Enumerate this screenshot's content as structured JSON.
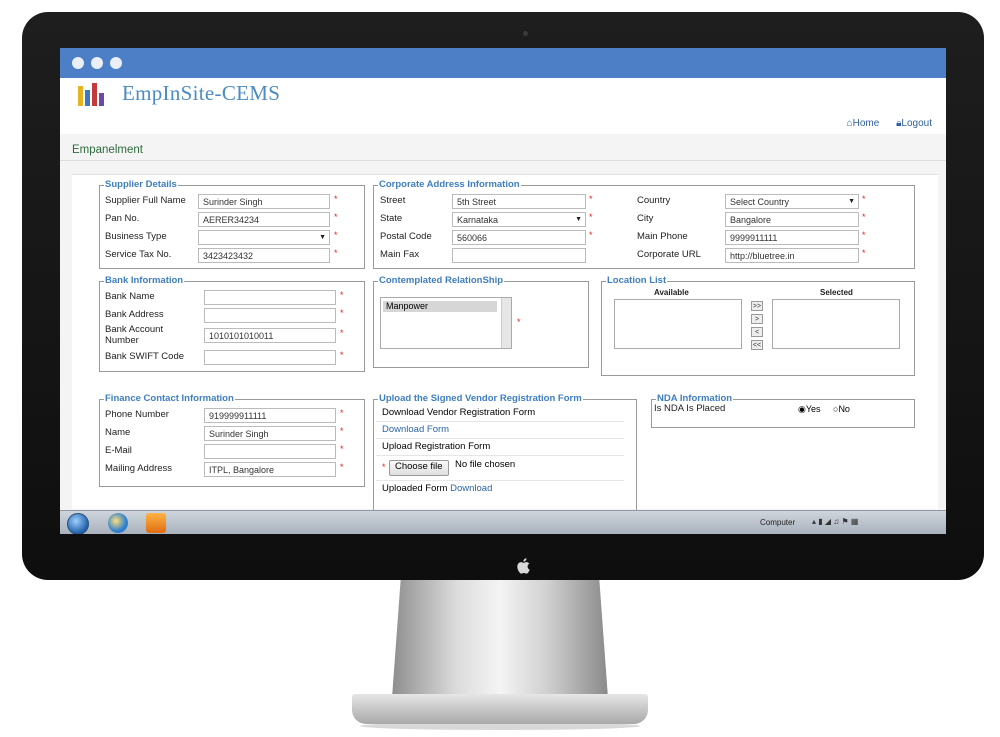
{
  "app": {
    "logo_text": "EmpInSite-CEMS",
    "nav": {
      "home": "Home",
      "logout": "Logout"
    },
    "page_title": "Empanelment"
  },
  "supplier": {
    "legend": "Supplier Details",
    "full_name_label": "Supplier Full Name",
    "full_name_value": "Surinder Singh",
    "pan_label": "Pan No.",
    "pan_value": "AERER34234",
    "business_type_label": "Business Type",
    "business_type_value": "",
    "service_tax_label": "Service Tax No.",
    "service_tax_value": "3423423432"
  },
  "address": {
    "legend": "Corporate Address Information",
    "street_label": "Street",
    "street_value": "5th Street",
    "state_label": "State",
    "state_value": "Karnataka",
    "postal_label": "Postal Code",
    "postal_value": "560066",
    "fax_label": "Main Fax",
    "fax_value": "",
    "country_label": "Country",
    "country_value": "Select Country",
    "city_label": "City",
    "city_value": "Bangalore",
    "phone_label": "Main Phone",
    "phone_value": "9999911111",
    "url_label": "Corporate URL",
    "url_value": "http://bluetree.in"
  },
  "bank": {
    "legend": "Bank Information",
    "name_label": "Bank Name",
    "name_value": "",
    "address_label": "Bank Address",
    "address_value": "",
    "account_label_1": "Bank Account",
    "account_label_2": "Number",
    "account_value": "1010101010011",
    "swift_label": "Bank SWIFT Code",
    "swift_value": ""
  },
  "relationship": {
    "legend": "Contemplated RelationShip",
    "options": [
      "Manpower"
    ]
  },
  "location": {
    "legend": "Location List",
    "available_label": "Available",
    "selected_label": "Selected",
    "buttons": [
      ">>",
      ">",
      "<",
      "<<"
    ]
  },
  "finance": {
    "legend": "Finance Contact Information",
    "phone_label": "Phone Number",
    "phone_value": "919999911111",
    "name_label": "Name",
    "name_value": "Surinder Singh",
    "email_label": "E-Mail",
    "email_value": "",
    "mailing_label": "Mailing Address",
    "mailing_value": "ITPL, Bangalore"
  },
  "upload": {
    "legend": "Upload the Signed Vendor Registration Form",
    "download_title": "Download Vendor Registration Form",
    "download_link": "Download Form",
    "upload_title": "Upload Registration Form",
    "choose_button": "Choose file",
    "no_file": "No file chosen",
    "uploaded_prefix": "Uploaded Form",
    "uploaded_link": "Download"
  },
  "nda": {
    "legend": "NDA Information",
    "question": "Is NDA Is Placed",
    "options": [
      "Yes",
      "No"
    ],
    "selected": "Yes"
  },
  "taskbar": {
    "computer_label": "Computer"
  },
  "colors": {
    "titlebar": "#4c7fc6",
    "legend": "#3f7ec0",
    "required": "#d22222",
    "page_title": "#2d6a3e"
  }
}
